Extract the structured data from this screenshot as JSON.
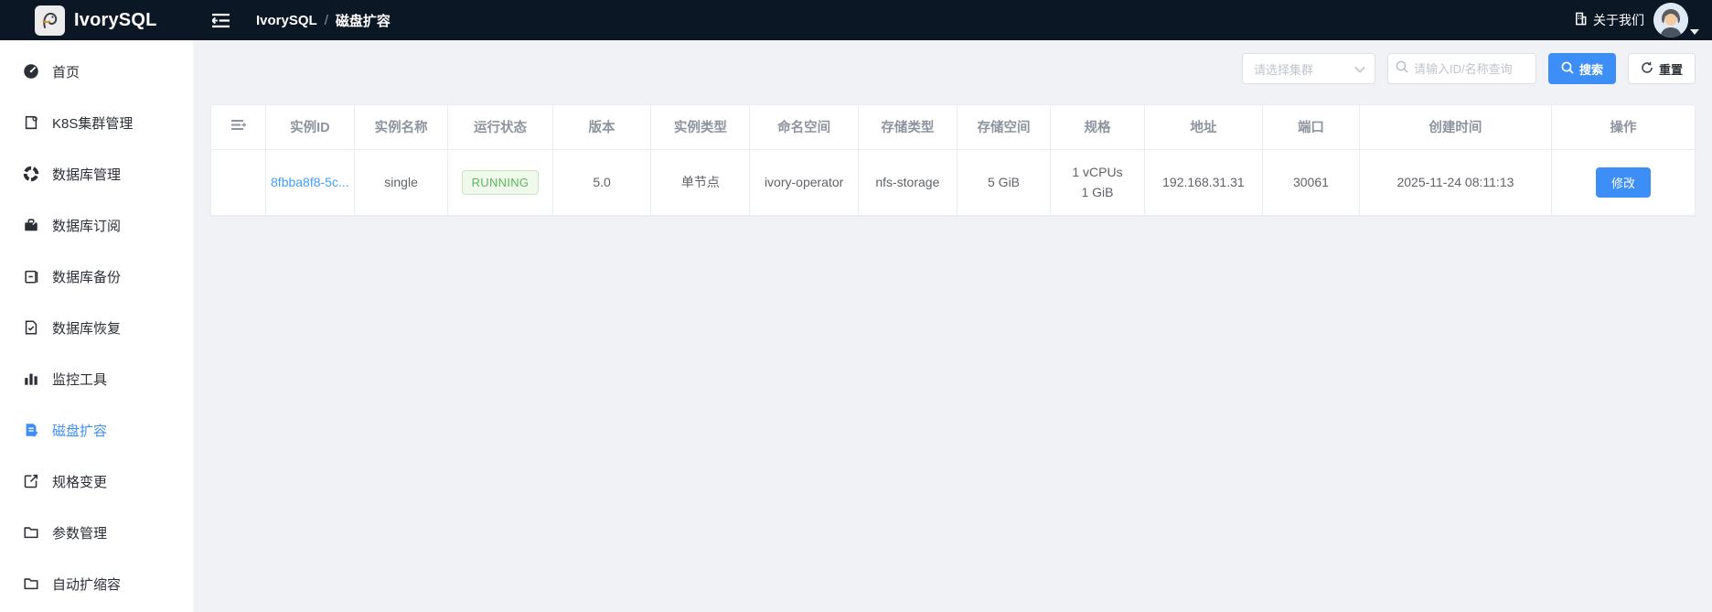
{
  "theme": {
    "accent": "#3d8ef7",
    "link": "#409eff",
    "header_bg": "#0b1724",
    "content_bg": "#f0f2f5",
    "table_border": "#e9ecf2",
    "success_text": "#5cb85c",
    "success_bg": "#f0f9eb",
    "success_border": "#c9e8bd"
  },
  "header": {
    "brand": "IvorySQL",
    "breadcrumb_root": "IvorySQL",
    "breadcrumb_separator": "/",
    "breadcrumb_current": "磁盘扩容",
    "about_label": "关于我们"
  },
  "sidebar": {
    "items": [
      {
        "label": "首页",
        "icon": "dashboard-icon"
      },
      {
        "label": "K8S集群管理",
        "icon": "cluster-icon"
      },
      {
        "label": "数据库管理",
        "icon": "database-manage-icon"
      },
      {
        "label": "数据库订阅",
        "icon": "subscription-icon"
      },
      {
        "label": "数据库备份",
        "icon": "backup-icon"
      },
      {
        "label": "数据库恢复",
        "icon": "restore-icon"
      },
      {
        "label": "监控工具",
        "icon": "monitor-icon"
      },
      {
        "label": "磁盘扩容",
        "icon": "disk-expand-icon",
        "active": true
      },
      {
        "label": "规格变更",
        "icon": "spec-change-icon"
      },
      {
        "label": "参数管理",
        "icon": "param-icon"
      },
      {
        "label": "自动扩缩容",
        "icon": "autoscale-icon"
      }
    ]
  },
  "toolbar": {
    "cluster_select_placeholder": "请选择集群",
    "search_input_placeholder": "请输入ID/名称查询",
    "search_button": "搜索",
    "reset_button": "重置"
  },
  "table": {
    "columns": [
      "",
      "实例ID",
      "实例名称",
      "运行状态",
      "版本",
      "实例类型",
      "命名空间",
      "存储类型",
      "存储空间",
      "规格",
      "地址",
      "端口",
      "创建时间",
      "操作"
    ],
    "rows": [
      {
        "instance_id": "8fbba8f8-5c...",
        "instance_name": "single",
        "status": "RUNNING",
        "version": "5.0",
        "instance_type": "单节点",
        "namespace": "ivory-operator",
        "storage_type": "nfs-storage",
        "storage_size": "5 GiB",
        "spec_cpu": "1 vCPUs",
        "spec_mem": "1 GiB",
        "address": "192.168.31.31",
        "port": "30061",
        "created_at": "2025-11-24 08:11:13",
        "action_label": "修改"
      }
    ]
  }
}
